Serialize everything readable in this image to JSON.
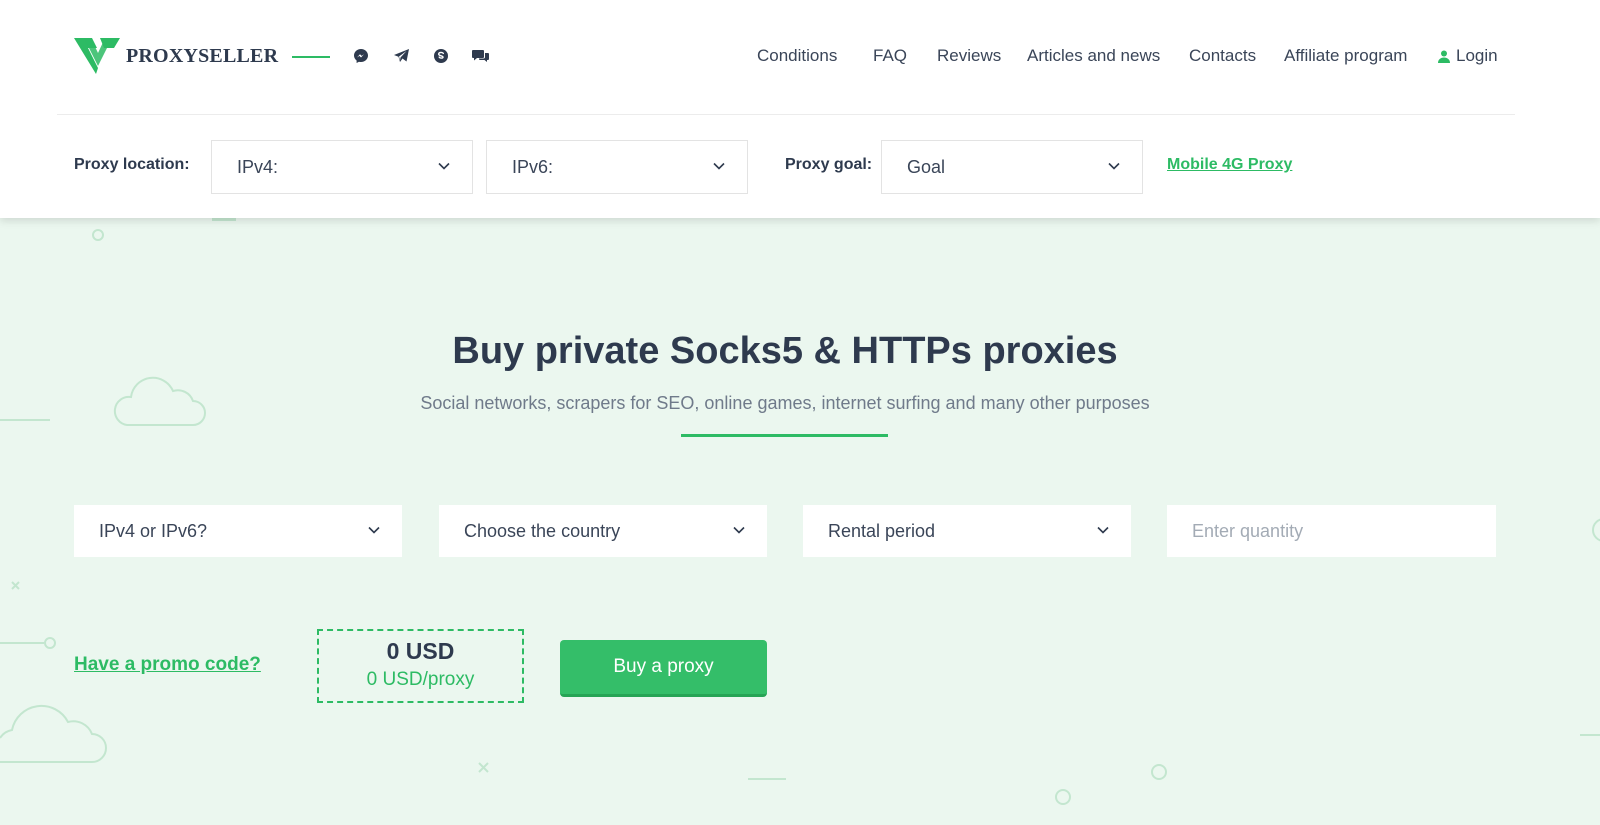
{
  "brand": {
    "name": "PROXYSELLER",
    "color": "#2dbb64"
  },
  "social_icons": [
    "messenger-icon",
    "telegram-icon",
    "skype-icon",
    "chat-icon"
  ],
  "nav": {
    "conditions": "Conditions",
    "faq": "FAQ",
    "reviews": "Reviews",
    "articles": "Articles and news",
    "contacts": "Contacts",
    "affiliate": "Affiliate program",
    "login": "Login"
  },
  "filters": {
    "location_label": "Proxy location:",
    "ipv4": "IPv4:",
    "ipv6": "IPv6:",
    "goal_label": "Proxy goal:",
    "goal": "Goal",
    "mobile_link": "Mobile 4G Proxy"
  },
  "hero": {
    "title": "Buy private Socks5 & HTTPs proxies",
    "subtitle": "Social networks, scrapers for SEO, online games, internet surfing and many other purposes"
  },
  "order": {
    "ip_version": "IPv4 or IPv6?",
    "country": "Choose the country",
    "period": "Rental period",
    "quantity_placeholder": "Enter quantity",
    "promo": "Have a promo code?",
    "total": "0 USD",
    "per_proxy": "0 USD/proxy",
    "buy_label": "Buy a proxy"
  }
}
